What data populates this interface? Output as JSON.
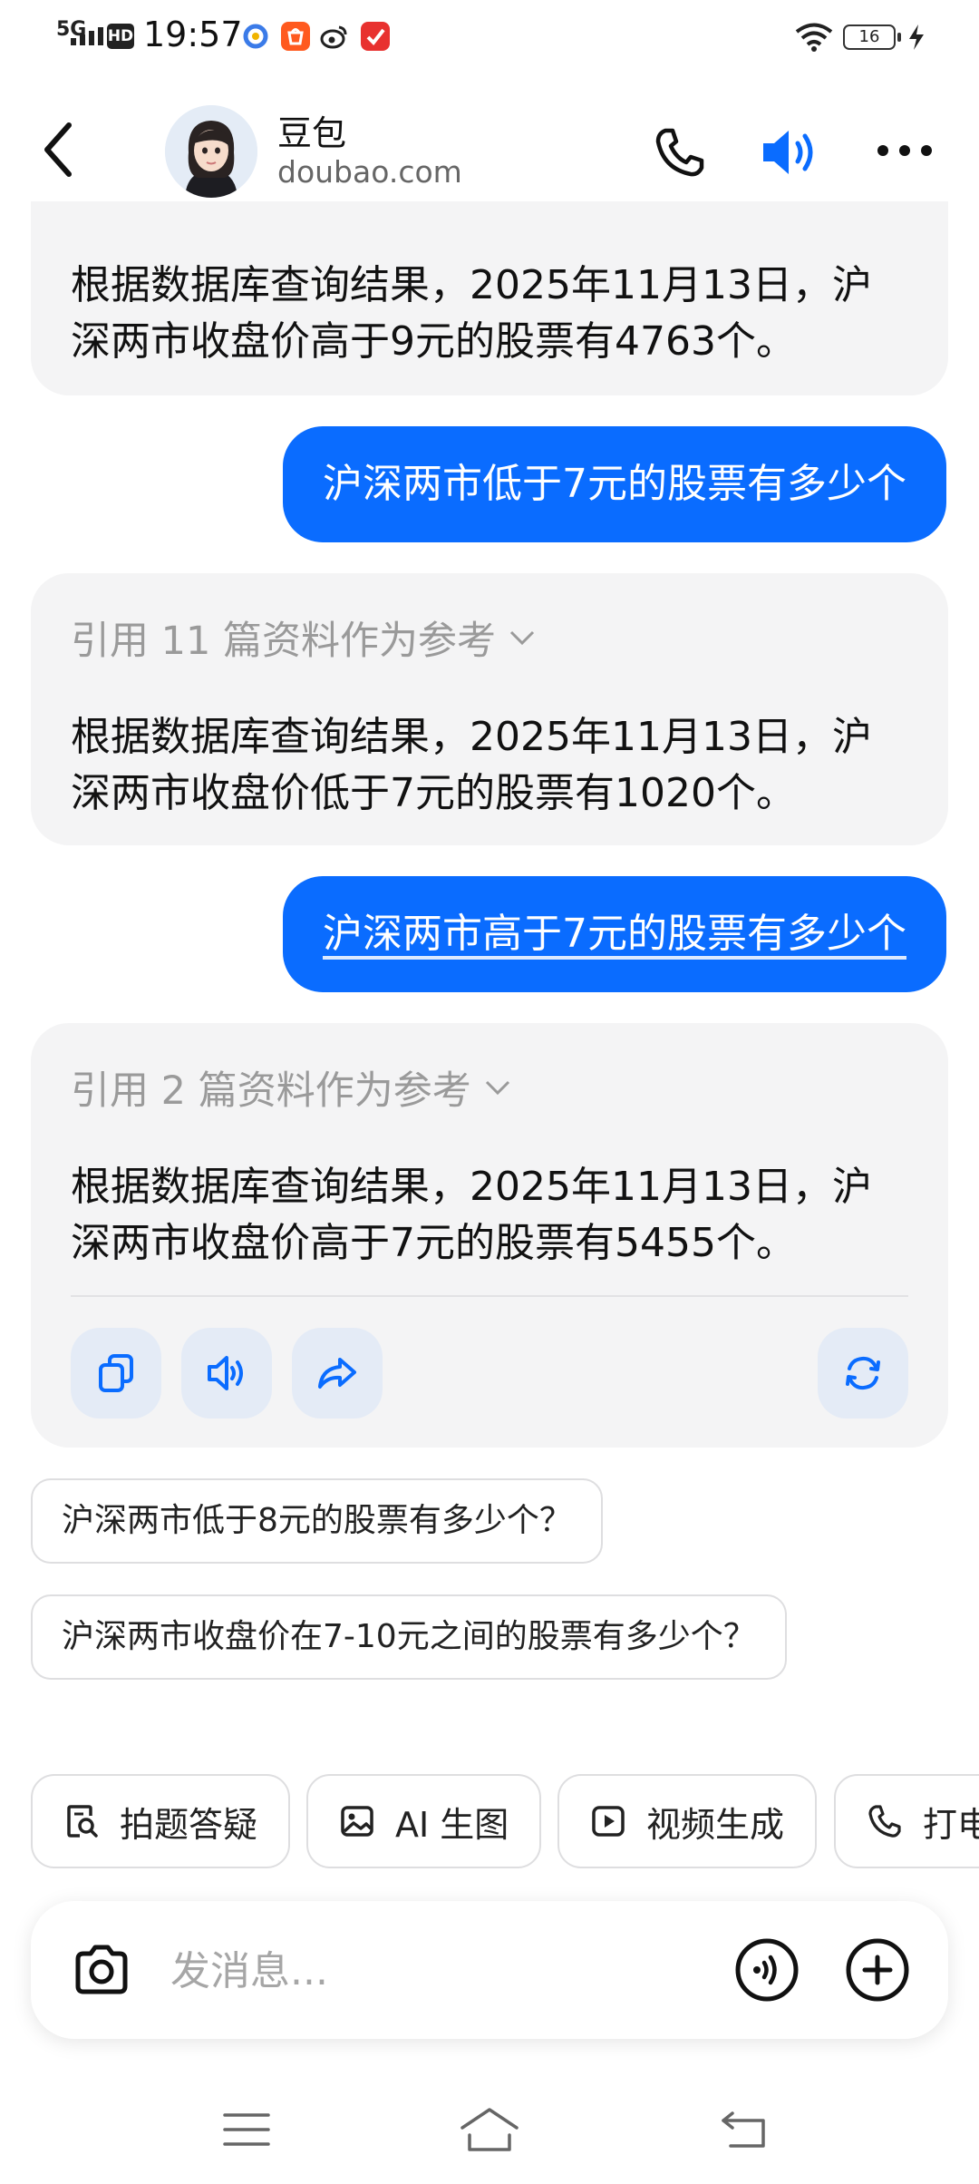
{
  "status_bar": {
    "network": "5G",
    "hd": "HD",
    "time": "19:57",
    "battery": "16"
  },
  "header": {
    "title": "豆包",
    "subtitle": "doubao.com"
  },
  "messages": [
    {
      "role": "bot",
      "text": "根据数据库查询结果，2025年11月13日，沪深两市收盘价高于9元的股票有4763个。"
    },
    {
      "role": "user",
      "text": "沪深两市低于7元的股票有多少个"
    },
    {
      "role": "bot",
      "cite": "引用 11 篇资料作为参考",
      "text": "根据数据库查询结果，2025年11月13日，沪深两市收盘价低于7元的股票有1020个。"
    },
    {
      "role": "user",
      "text": "沪深两市高于7元的股票有多少个"
    },
    {
      "role": "bot",
      "cite": "引用 2 篇资料作为参考",
      "text": "根据数据库查询结果，2025年11月13日，沪深两市收盘价高于7元的股票有5455个。"
    }
  ],
  "suggestions": [
    "沪深两市低于8元的股票有多少个？",
    "沪深两市收盘价在7-10元之间的股票有多少个？"
  ],
  "chips": [
    {
      "label": "拍题答疑",
      "icon": "search-doc-icon"
    },
    {
      "label": "AI 生图",
      "icon": "image-icon"
    },
    {
      "label": "视频生成",
      "icon": "play-icon"
    },
    {
      "label": "打电话",
      "icon": "phone-icon"
    }
  ],
  "input": {
    "placeholder": "发消息..."
  },
  "colors": {
    "accent": "#0a6cff",
    "bot_bubble": "#f4f4f5",
    "action_button": "#e4ebf6"
  }
}
